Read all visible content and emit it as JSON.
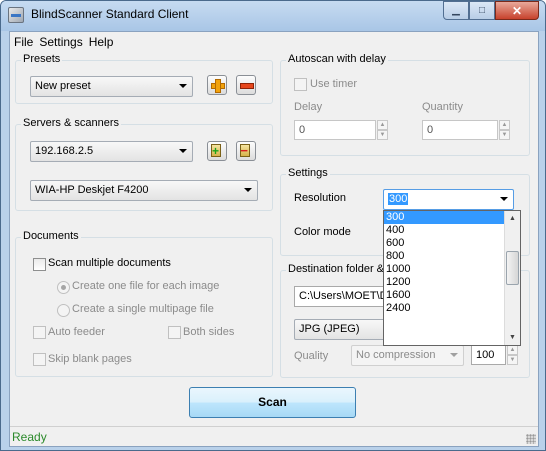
{
  "window": {
    "title": "BlindScanner Standard Client",
    "min_glyph": "▁",
    "max_glyph": "□",
    "close_glyph": "✕"
  },
  "menu": {
    "items": [
      "File",
      "Settings",
      "Help"
    ]
  },
  "presets": {
    "legend": "Presets",
    "selected": "New preset"
  },
  "servers": {
    "legend": "Servers & scanners",
    "server": "192.168.2.5",
    "scanner": "WIA-HP Deskjet F4200"
  },
  "documents": {
    "legend": "Documents",
    "scan_multiple": "Scan multiple documents",
    "one_file": "Create one file for each image",
    "single_multipage": "Create a single multipage file",
    "auto_feeder": "Auto feeder",
    "both_sides": "Both sides",
    "skip_blank": "Skip blank pages"
  },
  "autoscan": {
    "legend": "Autoscan with delay",
    "use_timer": "Use timer",
    "delay_label": "Delay",
    "delay_value": "0",
    "quantity_label": "Quantity",
    "quantity_value": "0"
  },
  "settings": {
    "legend": "Settings",
    "resolution_label": "Resolution",
    "resolution_value": "300",
    "color_mode_label": "Color mode",
    "resolution_options": [
      "300",
      "400",
      "600",
      "800",
      "1000",
      "1200",
      "1600",
      "2400"
    ],
    "selected_option_index": 0
  },
  "destination": {
    "legend": "Destination folder &",
    "path": "C:\\Users\\MOET\\D",
    "format": "JPG (JPEG)",
    "quality_label": "Quality",
    "compression": "No compression",
    "quality_value": "100"
  },
  "actions": {
    "scan_label": "Scan"
  },
  "status": {
    "text": "Ready"
  },
  "colors": {
    "status_text": "#2b8a2b",
    "selection": "#3399ff",
    "close_button": "#c7422c"
  }
}
